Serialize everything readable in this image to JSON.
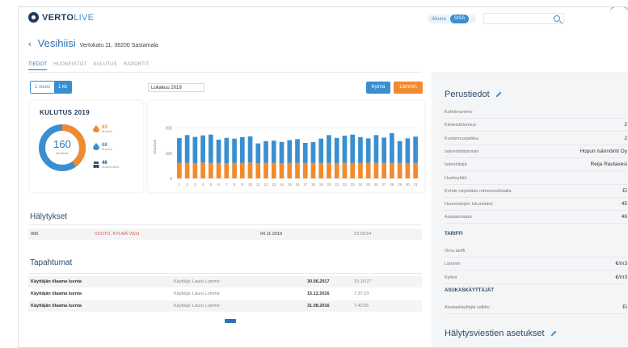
{
  "brand": {
    "name": "VERTO",
    "suffix": "LIVE"
  },
  "header": {
    "lang_a": "Ikkuna",
    "lang_b": "SISÄ",
    "search_placeholder": ""
  },
  "page": {
    "back": "‹",
    "title": "Vesihiisi",
    "address": "Vertokatu 11, 38200 Sastamala"
  },
  "tabs": [
    {
      "label": "TIEDOT",
      "active": true
    },
    {
      "label": "HUONEISTOT",
      "active": false
    },
    {
      "label": "KULUTUS",
      "active": false
    },
    {
      "label": "RAPORTIT",
      "active": false
    }
  ],
  "controls": {
    "range_a": "1 vuosi",
    "range_b": "1 kk",
    "month": "Lokakuu 2019",
    "cold": "Kylmä",
    "warm": "Lämmin"
  },
  "summary": {
    "title": "KULUTUS 2019",
    "total": "160",
    "total_sub": "litraa/vrk",
    "warm_value": "63",
    "warm_sub": "litraa/vrk",
    "cold_value": "68",
    "cold_sub": "litraa/vrk",
    "people_value": "46",
    "people_sub": "asukasmäärä",
    "warm_share": 0.4,
    "colors": {
      "cold": "#3a8fd0",
      "warm": "#f28a2e",
      "people": "#2d4a6b"
    }
  },
  "chart_data": {
    "type": "bar",
    "stacked": true,
    "ylabel": "Litraa/vrk",
    "ylim": [
      0,
      250
    ],
    "yticks": [
      0,
      100,
      200
    ],
    "categories": [
      "1",
      "2",
      "3",
      "4",
      "5",
      "6",
      "7",
      "8",
      "9",
      "10",
      "11",
      "12",
      "13",
      "14",
      "15",
      "16",
      "17",
      "18",
      "19",
      "20",
      "21",
      "22",
      "23",
      "24",
      "25",
      "26",
      "27",
      "28",
      "29",
      "30",
      "31"
    ],
    "series": [
      {
        "name": "Lämmin",
        "color": "#f28a2e",
        "values": [
          62,
          62,
          61,
          63,
          62,
          62,
          61,
          62,
          62,
          63,
          61,
          62,
          62,
          61,
          62,
          62,
          61,
          62,
          62,
          62,
          61,
          62,
          62,
          62,
          63,
          62,
          62,
          62,
          62,
          61,
          62
        ]
      },
      {
        "name": "Kylmä",
        "color": "#3a8fd0",
        "values": [
          98,
          110,
          104,
          108,
          112,
          92,
          100,
          96,
          102,
          104,
          78,
          86,
          88,
          84,
          90,
          94,
          80,
          82,
          96,
          110,
          100,
          108,
          112,
          102,
          96,
          110,
          100,
          118,
          86,
          98,
          104
        ]
      }
    ],
    "grid": true
  },
  "alerts": {
    "title": "Hälytykset",
    "rows": [
      {
        "code": "006",
        "type": "VUOTO, KYLMÄ VESI",
        "date": "04.11.2019",
        "time": "23:58:54"
      }
    ],
    "color": "#e05340"
  },
  "events": {
    "title": "Tapahtumat",
    "rows": [
      {
        "event": "Käyttäjän tilaama luenta",
        "user": "Käyttäjä: Laura Lumme",
        "date": "30.06.2017",
        "time": "10:10:27"
      },
      {
        "event": "Käyttäjän tilaama luenta",
        "user": "Käyttäjä: Laura Lumme",
        "date": "15.12.2016",
        "time": "7:37:23"
      },
      {
        "event": "Käyttäjän tilaama luenta",
        "user": "Käyttäjä: Laura Lumme",
        "date": "31.08.2016",
        "time": "7:42:55"
      }
    ]
  },
  "side": {
    "basic_title": "Perustiedot",
    "basic": [
      {
        "k": "Kohdenumero",
        "v": ""
      },
      {
        "k": "Kiinteistötunnus",
        "v": "2"
      },
      {
        "k": "Kustannuspaikka",
        "v": "2"
      },
      {
        "k": "Isännöintitoimisto",
        "v": "Hopun isännöinti Oy"
      },
      {
        "k": "Isännöitsijä",
        "v": "Reija Rautavesi"
      },
      {
        "k": "Huoltoyhtiö",
        "v": ""
      },
      {
        "k": "Kohde näytetään referenssilistalla",
        "v": "Ei"
      },
      {
        "k": "Huoneistojen lukumäärä",
        "v": "45"
      },
      {
        "k": "Asukasmäärä",
        "v": "46"
      }
    ],
    "tariff_title": "TARIFFI",
    "tariff": [
      {
        "k": "Oma tariffi",
        "v": ""
      },
      {
        "k": "Lämmin",
        "v": "€/m3"
      },
      {
        "k": "Kylmä",
        "v": "€/m3"
      }
    ],
    "residents_title": "ASUKASKÄYTTÄJÄT",
    "residents": [
      {
        "k": "Asukaskäyttäjät sallittu",
        "v": "Ei"
      }
    ],
    "alerts_title": "Hälytysviestien asetukset"
  }
}
